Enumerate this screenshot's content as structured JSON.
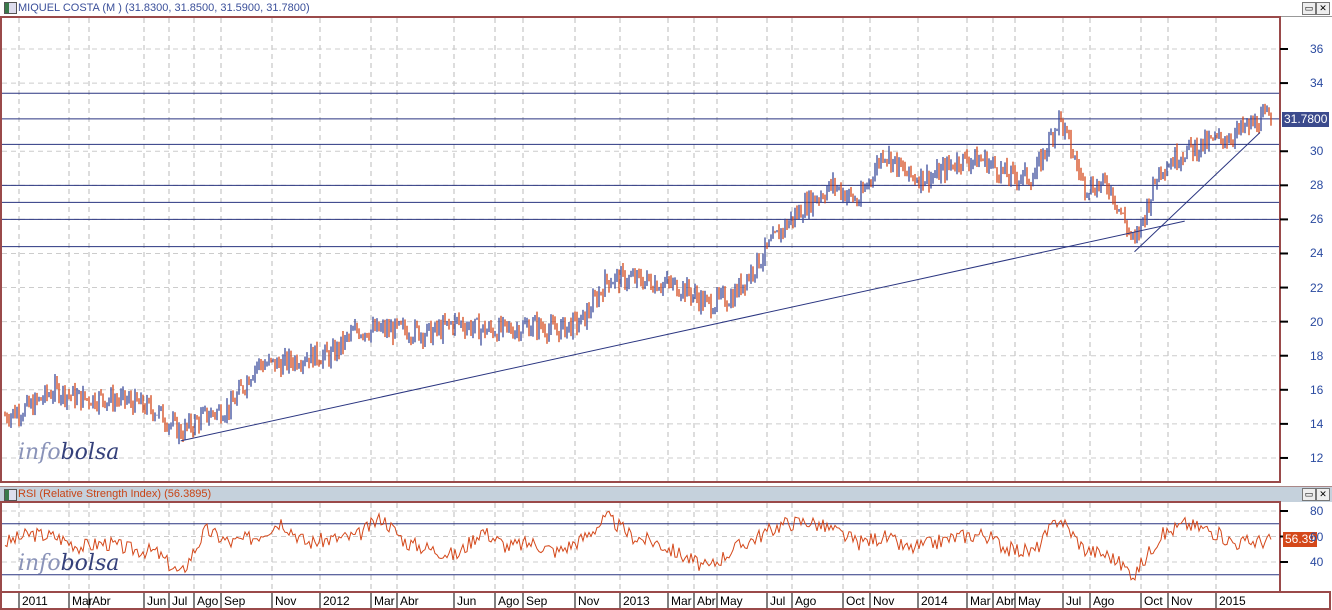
{
  "main_panel": {
    "title": "MIQUEL COSTA (M ) (31.8300, 31.8500, 31.5900, 31.7800)",
    "last_price_label": "31.7800"
  },
  "rsi_panel": {
    "title": "RSI (Relative Strength Index) (56.3895)",
    "last_value_label": "56.39"
  },
  "window_buttons": {
    "maximize": "▭",
    "close": "✕"
  },
  "watermark": {
    "part1": "info",
    "part2": "bolsa"
  },
  "colors": {
    "up": "#3a4a9a",
    "down": "#d4481a",
    "rsi": "#d4481a",
    "lines": "#2a3580",
    "frame": "#9a4a4a"
  },
  "chart_data": [
    {
      "type": "bar",
      "title": "MIQUEL COSTA (M )",
      "ylim": [
        11,
        37.5
      ],
      "yticks": [
        "12",
        "14",
        "16",
        "18",
        "20",
        "22",
        "24",
        "26",
        "28",
        "30",
        "34",
        "36"
      ],
      "months": [
        "2011-01",
        "2011-02",
        "2011-03",
        "2011-04",
        "2011-05",
        "2011-06",
        "2011-07",
        "2011-08",
        "2011-09",
        "2011-10",
        "2011-11",
        "2011-12",
        "2012-01",
        "2012-02",
        "2012-03",
        "2012-04",
        "2012-05",
        "2012-06",
        "2012-07",
        "2012-08",
        "2012-09",
        "2012-10",
        "2012-11",
        "2012-12",
        "2013-01",
        "2013-02",
        "2013-03",
        "2013-04",
        "2013-05",
        "2013-06",
        "2013-07",
        "2013-08",
        "2013-09",
        "2013-10",
        "2013-11",
        "2013-12",
        "2014-01",
        "2014-02",
        "2014-03",
        "2014-04",
        "2014-05",
        "2014-06",
        "2014-07",
        "2014-08",
        "2014-09",
        "2014-10",
        "2014-11",
        "2014-12",
        "2015-01",
        "2015-02",
        "2015-03"
      ],
      "close": [
        14.5,
        15,
        16,
        15.5,
        15.5,
        15.3,
        14.8,
        13.5,
        14.5,
        15,
        17.5,
        17.5,
        18,
        18,
        19.5,
        19.5,
        19.5,
        19.3,
        20,
        19.5,
        19.5,
        19.8,
        19.5,
        20,
        22.5,
        22.5,
        22.3,
        22,
        21,
        21.5,
        23.5,
        25.5,
        27,
        28,
        27,
        30,
        28.5,
        28.5,
        29.5,
        29.5,
        28.5,
        28.5,
        32,
        28,
        28,
        24.5,
        29,
        30,
        30.5,
        31,
        31.8
      ],
      "horizontal_lines": [
        33.4,
        31.9,
        30.4,
        28,
        27,
        26,
        24.4
      ],
      "trendlines": [
        {
          "from": [
            "2011-08",
            13
          ],
          "to": [
            "2014-12",
            25.9
          ]
        },
        {
          "from": [
            "2014-10",
            24.1
          ],
          "to": [
            "2015-03",
            31.1
          ]
        }
      ]
    },
    {
      "type": "line",
      "title": "RSI (Relative Strength Index)",
      "ylim": [
        25,
        88
      ],
      "yticks": [
        "40",
        "60",
        "80"
      ],
      "levels": [
        70,
        30
      ],
      "values": [
        55,
        62,
        60,
        52,
        55,
        50,
        48,
        30,
        65,
        55,
        60,
        72,
        55,
        58,
        60,
        75,
        55,
        50,
        45,
        65,
        52,
        55,
        48,
        58,
        75,
        60,
        55,
        45,
        35,
        50,
        60,
        70,
        72,
        65,
        55,
        60,
        50,
        55,
        60,
        62,
        50,
        48,
        75,
        50,
        45,
        30,
        60,
        70,
        65,
        55,
        56.4
      ]
    }
  ],
  "x_axis_labels": [
    "2011",
    "Mar",
    "Abr",
    "Jun",
    "Jul",
    "Ago",
    "Sep",
    "Nov",
    "2012",
    "Mar",
    "Abr",
    "Jun",
    "Ago",
    "Sep",
    "Nov",
    "2013",
    "Mar",
    "Abr",
    "May",
    "Jul",
    "Ago",
    "Oct",
    "Nov",
    "2014",
    "Mar",
    "Abr",
    "May",
    "Jul",
    "Ago",
    "Oct",
    "Nov",
    "2015"
  ]
}
